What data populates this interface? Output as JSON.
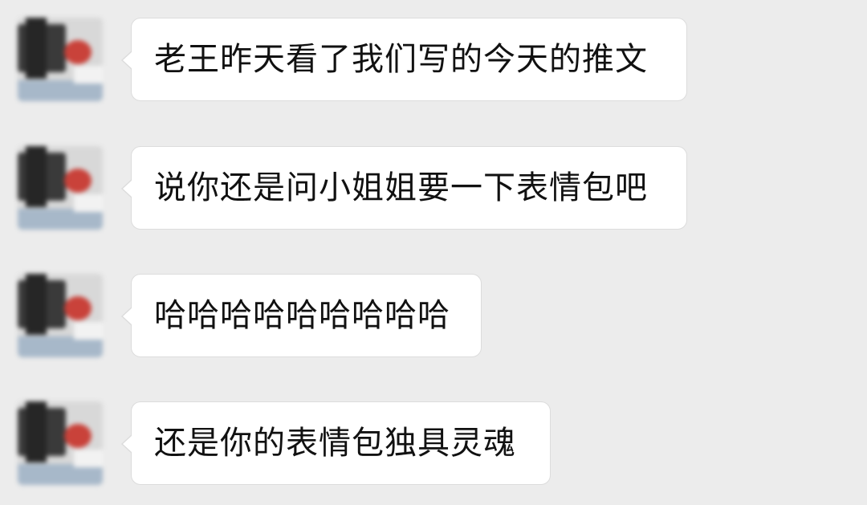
{
  "messages": [
    {
      "text": "老王昨天看了我们写的今天的推文"
    },
    {
      "text": "说你还是问小姐姐要一下表情包吧"
    },
    {
      "text": "哈哈哈哈哈哈哈哈哈"
    },
    {
      "text": "还是你的表情包独具灵魂"
    }
  ],
  "colors": {
    "background": "#ececec",
    "bubble": "#ffffff",
    "bubble_border": "#dcdcdc",
    "text": "#111111"
  }
}
